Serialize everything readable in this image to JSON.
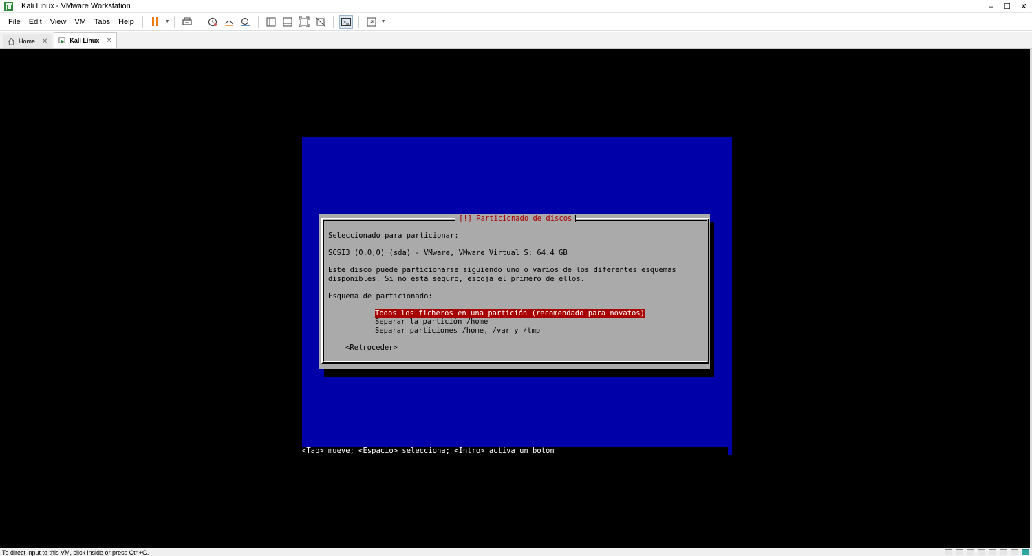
{
  "window": {
    "title": "Kali Linux - VMware Workstation",
    "controls": {
      "minimize": "–",
      "maximize": "☐",
      "close": "✕"
    }
  },
  "menu": {
    "items": [
      "File",
      "Edit",
      "View",
      "VM",
      "Tabs",
      "Help"
    ]
  },
  "toolbar": {
    "icons": [
      "pause-icon",
      "send-ctrl-alt-del-icon",
      "snapshot-icon",
      "revert-snapshot-icon",
      "snapshot-manager-icon",
      "view-sidebar-icon",
      "view-thumbnail-icon",
      "full-screen-icon",
      "unity-icon",
      "console-view-icon",
      "stretch-guest-icon"
    ]
  },
  "tabs": [
    {
      "label": "Home",
      "icon": "home-icon",
      "active": false
    },
    {
      "label": "Kali Linux",
      "icon": "vm-icon",
      "active": true
    }
  ],
  "installer": {
    "dialog_title": "[!] Particionado de discos",
    "lines": {
      "selected_for": "Seleccionado para particionar:",
      "disk": "SCSI3 (0,0,0) (sda) - VMware, VMware Virtual S: 64.4 GB",
      "desc1": "Este disco puede particionarse siguiendo uno o varios de los diferentes esquemas",
      "desc2": "disponibles. Si no está seguro, escoja el primero de ellos.",
      "scheme_label": "Esquema de particionado:"
    },
    "options": [
      "Todos los ficheros en una partición (recomendado para novatos)",
      "Separar la partición /home",
      "Separar particiones /home, /var y /tmp"
    ],
    "selected_option_index": 0,
    "back_button": "<Retroceder>",
    "footer_help": "<Tab> mueve; <Espacio> selecciona; <Intro> activa un botón",
    "colors": {
      "background": "#0000a8",
      "dialog": "#aaaaaa",
      "highlight": "#a80000",
      "title": "#a80000"
    }
  },
  "statusbar": {
    "text": "To direct input to this VM, click inside or press Ctrl+G."
  }
}
